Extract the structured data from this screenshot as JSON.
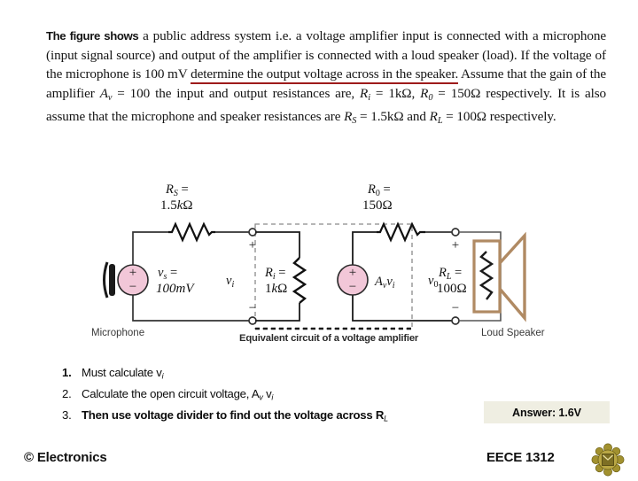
{
  "problem": {
    "lead": "The figure shows",
    "body_part1": " a   public   address   system i.e.  a voltage  amplifier  input  is connected  with  a microphone  (input  signal  source)  and  output  of  the  amplifier  is connected with  a loud  speaker  (load).  If   the  voltage  of  the  microphone  is 100 mV ",
    "underlined": "determine the output voltage across in the speaker.",
    "body_part2": "  Assume that the gain of the amplifier ",
    "gain_expr": "A",
    "gain_sub": "v",
    "gain_val": " = 100",
    "body_part3": " the  input  and  output  resistances  are, ",
    "ri_sym": "R",
    "ri_sub": "i",
    "ri_val": " = 1kΩ,",
    "ro_sym": "R",
    "ro_sub": "0",
    "ro_val": " = 150Ω",
    "body_part4": " respectively.   It  is  also  assume  that  the  microphone  and  speaker  resistances  are ",
    "rs_sym": "R",
    "rs_sub": "S",
    "rs_val": " = 1.5kΩ",
    "and_word": " and ",
    "rl_sym": "R",
    "rl_sub": "L",
    "rl_val": " = 100Ω",
    "body_part5": " respectively."
  },
  "figure": {
    "rs_label_line1": "R",
    "rs_label_sub": "S",
    "rs_label_eq": " =",
    "rs_label_line2": "1.5kΩ",
    "ro_label_line1": "R",
    "ro_label_sub": "0",
    "ro_label_eq": " =",
    "ro_label_line2": "150Ω",
    "vs_label_line1": "v",
    "vs_label_sub": "s",
    "vs_label_eq": " =",
    "vs_label_line2": "100mV",
    "vi_label": "v",
    "vi_label_sub": "i",
    "ri_label_line1": "R",
    "ri_label_sub": "i",
    "ri_label_eq": " =",
    "ri_label_line2": "1kΩ",
    "dep_src_label": "A",
    "dep_src_sub1": "v",
    "dep_src_label2": "v",
    "dep_src_sub2": "i",
    "vo_label": "v",
    "vo_label_sub": "0",
    "rl_label_line1": "R",
    "rl_label_sub": "L",
    "rl_label_eq": " =",
    "rl_label_line2": "100Ω",
    "plus_sign": "+",
    "minus_sign": "−",
    "microphone_label": "Microphone",
    "loudspeaker_label": "Loud Speaker",
    "equivalent_caption": "Equivalent circuit of a voltage amplifier",
    "source_fill_color": "#f2c7d8",
    "speaker_color": "#b08a63",
    "wire_color": "#333333",
    "dashed_box_color": "#888888"
  },
  "steps": [
    {
      "num": "1.",
      "text": "Must calculate v",
      "sub": "i",
      "tail": ""
    },
    {
      "num": "2.",
      "text": "Calculate the open circuit voltage, A",
      "sub": "v",
      "tail": " v",
      "sub2": "i"
    },
    {
      "num": "3.",
      "text": "Then use voltage divider to find out the voltage across R",
      "sub": "L",
      "tail": ""
    }
  ],
  "answer": {
    "label": "Answer: 1.6V",
    "background_color": "#efeee2"
  },
  "footer": {
    "copyright": "© Electronics",
    "course": "EECE 1312",
    "logo_name": "university-crest-logo",
    "logo_color": "#9a8a34"
  }
}
